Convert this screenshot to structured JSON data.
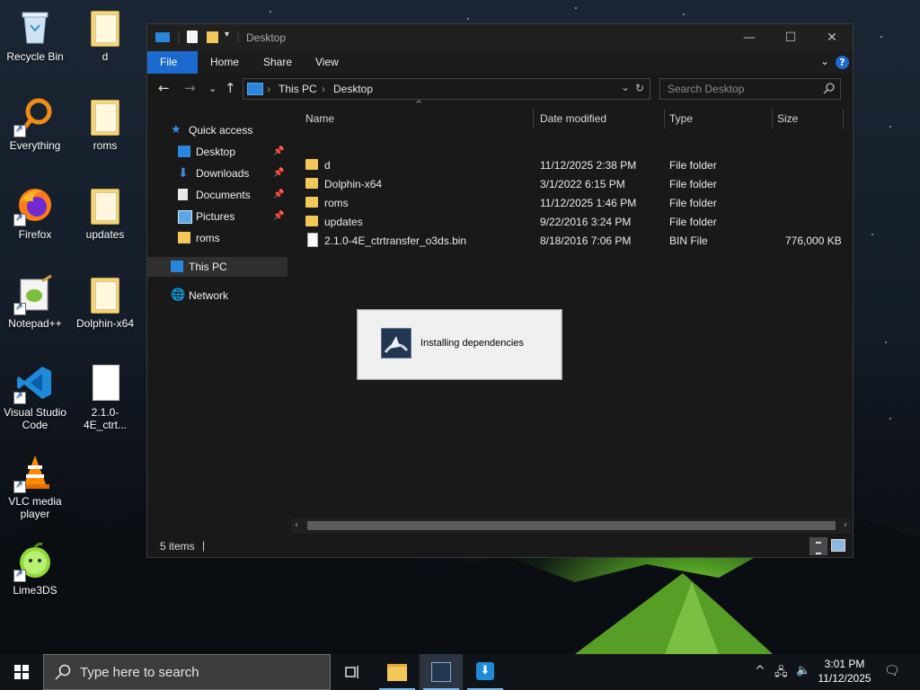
{
  "desktop": {
    "icons": [
      {
        "label": "Recycle Bin"
      },
      {
        "label": "Everything"
      },
      {
        "label": "Firefox"
      },
      {
        "label": "Notepad++"
      },
      {
        "label": "Visual Studio Code"
      },
      {
        "label": "VLC media player"
      },
      {
        "label": "Lime3DS"
      },
      {
        "label": "d"
      },
      {
        "label": "roms"
      },
      {
        "label": "updates"
      },
      {
        "label": "Dolphin-x64"
      },
      {
        "label": "2.1.0-4E_ctrt..."
      }
    ]
  },
  "explorer": {
    "title": "Desktop",
    "ribbon_tabs": [
      "File",
      "Home",
      "Share",
      "View"
    ],
    "breadcrumb": [
      "This PC",
      "Desktop"
    ],
    "search_placeholder": "Search Desktop",
    "nav": {
      "quick_access": "Quick access",
      "items": [
        "Desktop",
        "Downloads",
        "Documents",
        "Pictures",
        "roms"
      ],
      "this_pc": "This PC",
      "network": "Network"
    },
    "columns": [
      "Name",
      "Date modified",
      "Type",
      "Size"
    ],
    "files": [
      {
        "name": "d",
        "date": "11/12/2025 2:38 PM",
        "type": "File folder",
        "size": "",
        "kind": "folder"
      },
      {
        "name": "Dolphin-x64",
        "date": "3/1/2022 6:15 PM",
        "type": "File folder",
        "size": "",
        "kind": "folder"
      },
      {
        "name": "roms",
        "date": "11/12/2025 1:46 PM",
        "type": "File folder",
        "size": "",
        "kind": "folder"
      },
      {
        "name": "updates",
        "date": "9/22/2016 3:24 PM",
        "type": "File folder",
        "size": "",
        "kind": "folder"
      },
      {
        "name": "2.1.0-4E_ctrtransfer_o3ds.bin",
        "date": "8/18/2016 7:06 PM",
        "type": "BIN File",
        "size": "776,000 KB",
        "kind": "file"
      }
    ],
    "status": "5 items"
  },
  "dialog": {
    "message": "Installing dependencies"
  },
  "taskbar": {
    "search_placeholder": "Type here to search",
    "time": "3:01 PM",
    "date": "11/12/2025"
  }
}
